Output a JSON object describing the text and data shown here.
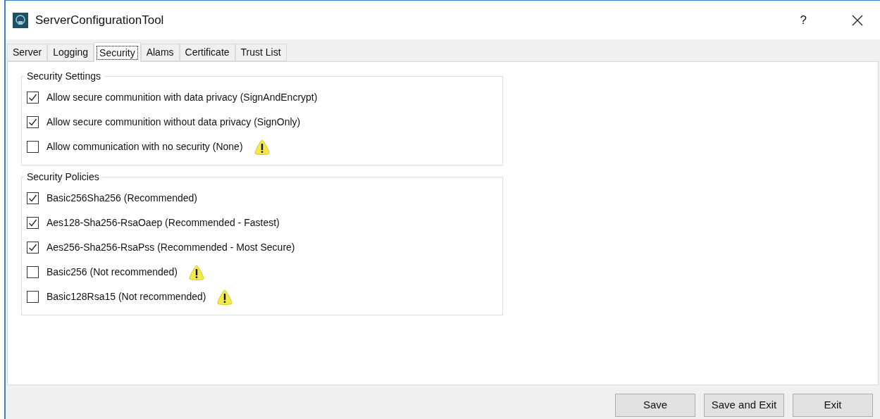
{
  "window": {
    "title": "ServerConfigurationTool",
    "help": "?"
  },
  "tabs": [
    {
      "label": "Server",
      "selected": false
    },
    {
      "label": "Logging",
      "selected": false
    },
    {
      "label": "Security",
      "selected": true
    },
    {
      "label": "Alams",
      "selected": false
    },
    {
      "label": "Certificate",
      "selected": false
    },
    {
      "label": "Trust List",
      "selected": false
    }
  ],
  "groups": [
    {
      "title": "Security Settings",
      "items": [
        {
          "label": "Allow secure communition with data privacy (SignAndEncrypt)",
          "checked": true,
          "warning": false
        },
        {
          "label": "Allow secure communition without data privacy (SignOnly)",
          "checked": true,
          "warning": false
        },
        {
          "label": "Allow communication with no security (None)",
          "checked": false,
          "warning": true
        }
      ]
    },
    {
      "title": "Security Policies",
      "items": [
        {
          "label": "Basic256Sha256 (Recommended)",
          "checked": true,
          "warning": false
        },
        {
          "label": "Aes128-Sha256-RsaOaep (Recommended - Fastest)",
          "checked": true,
          "warning": false
        },
        {
          "label": "Aes256-Sha256-RsaPss (Recommended - Most Secure)",
          "checked": true,
          "warning": false
        },
        {
          "label": "Basic256 (Not recommended)",
          "checked": false,
          "warning": true
        },
        {
          "label": "Basic128Rsa15 (Not recommended)",
          "checked": false,
          "warning": true
        }
      ]
    }
  ],
  "buttons": [
    "Save",
    "Save and Exit",
    "Exit"
  ]
}
